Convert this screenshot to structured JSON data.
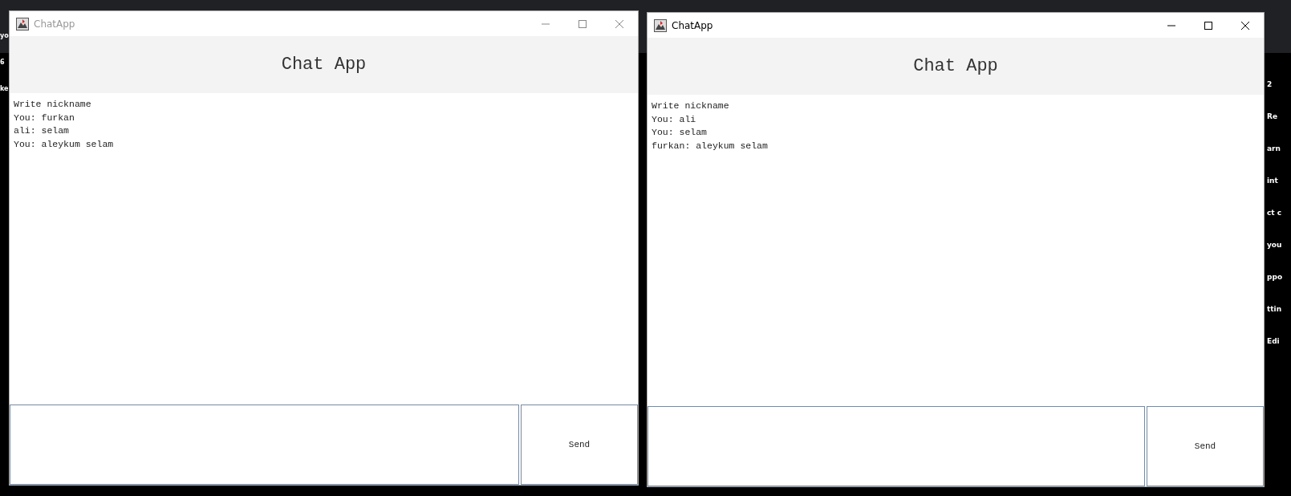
{
  "background": {
    "left_fragments": [
      "yo",
      "6",
      "ke"
    ],
    "right_fragments": [
      "2",
      "Re",
      "arn",
      "int",
      "ct c",
      "you",
      "ppo",
      "ttin",
      "Edi"
    ]
  },
  "windows": [
    {
      "title": "ChatApp",
      "active": false,
      "heading": "Chat App",
      "messages": [
        "Write nickname",
        "You: furkan",
        "ali: selam",
        "You: aleykum selam"
      ],
      "send_label": "Send"
    },
    {
      "title": "ChatApp",
      "active": true,
      "heading": "Chat App",
      "messages": [
        "Write nickname",
        "You: ali",
        "You: selam",
        "furkan: aleykum selam"
      ],
      "send_label": "Send"
    }
  ]
}
